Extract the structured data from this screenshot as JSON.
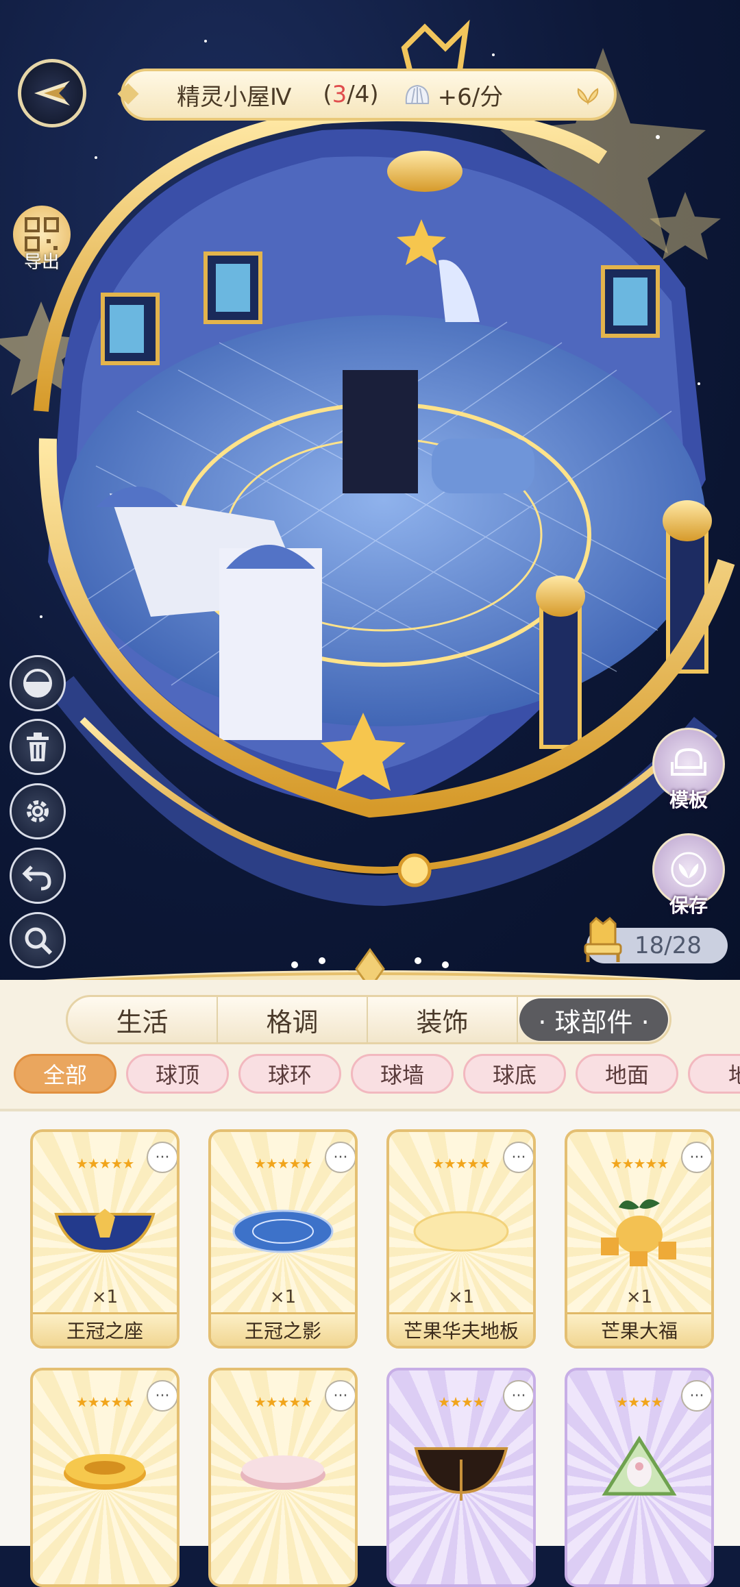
{
  "hud": {
    "house_name": "精灵小屋Ⅳ",
    "count_open": "(",
    "count_current": "3",
    "count_sep_total": "/4)",
    "rate": "+6/分",
    "export_label": "导出",
    "template_label": "模板",
    "save_label": "保存",
    "capacity": "18/28"
  },
  "tabs": [
    {
      "label": "生活",
      "active": false
    },
    {
      "label": "格调",
      "active": false
    },
    {
      "label": "装饰",
      "active": false
    },
    {
      "label": "· 球部件 ·",
      "active": true
    }
  ],
  "filters": [
    {
      "label": "全部",
      "active": true
    },
    {
      "label": "球顶",
      "active": false
    },
    {
      "label": "球环",
      "active": false
    },
    {
      "label": "球墙",
      "active": false
    },
    {
      "label": "球底",
      "active": false
    },
    {
      "label": "地面",
      "active": false
    },
    {
      "label": "地",
      "active": false
    }
  ],
  "items": [
    {
      "name": "王冠之座",
      "qty": "×1",
      "stars": "★★★★★",
      "rarity": "gold"
    },
    {
      "name": "王冠之影",
      "qty": "×1",
      "stars": "★★★★★",
      "rarity": "gold"
    },
    {
      "name": "芒果华夫地板",
      "qty": "×1",
      "stars": "★★★★★",
      "rarity": "gold"
    },
    {
      "name": "芒果大福",
      "qty": "×1",
      "stars": "★★★★★",
      "rarity": "gold"
    },
    {
      "name": "",
      "qty": "",
      "stars": "★★★★★",
      "rarity": "gold"
    },
    {
      "name": "",
      "qty": "",
      "stars": "★★★★★",
      "rarity": "gold"
    },
    {
      "name": "",
      "qty": "",
      "stars": "★★★★",
      "rarity": "purple"
    },
    {
      "name": "",
      "qty": "",
      "stars": "★★★★",
      "rarity": "purple"
    }
  ],
  "more_glyph": "···",
  "colors": {
    "accent": "#eaa65e",
    "gold": "#e4bf72",
    "dark_tab": "#5b5b5f",
    "sky": "#0d1838"
  }
}
